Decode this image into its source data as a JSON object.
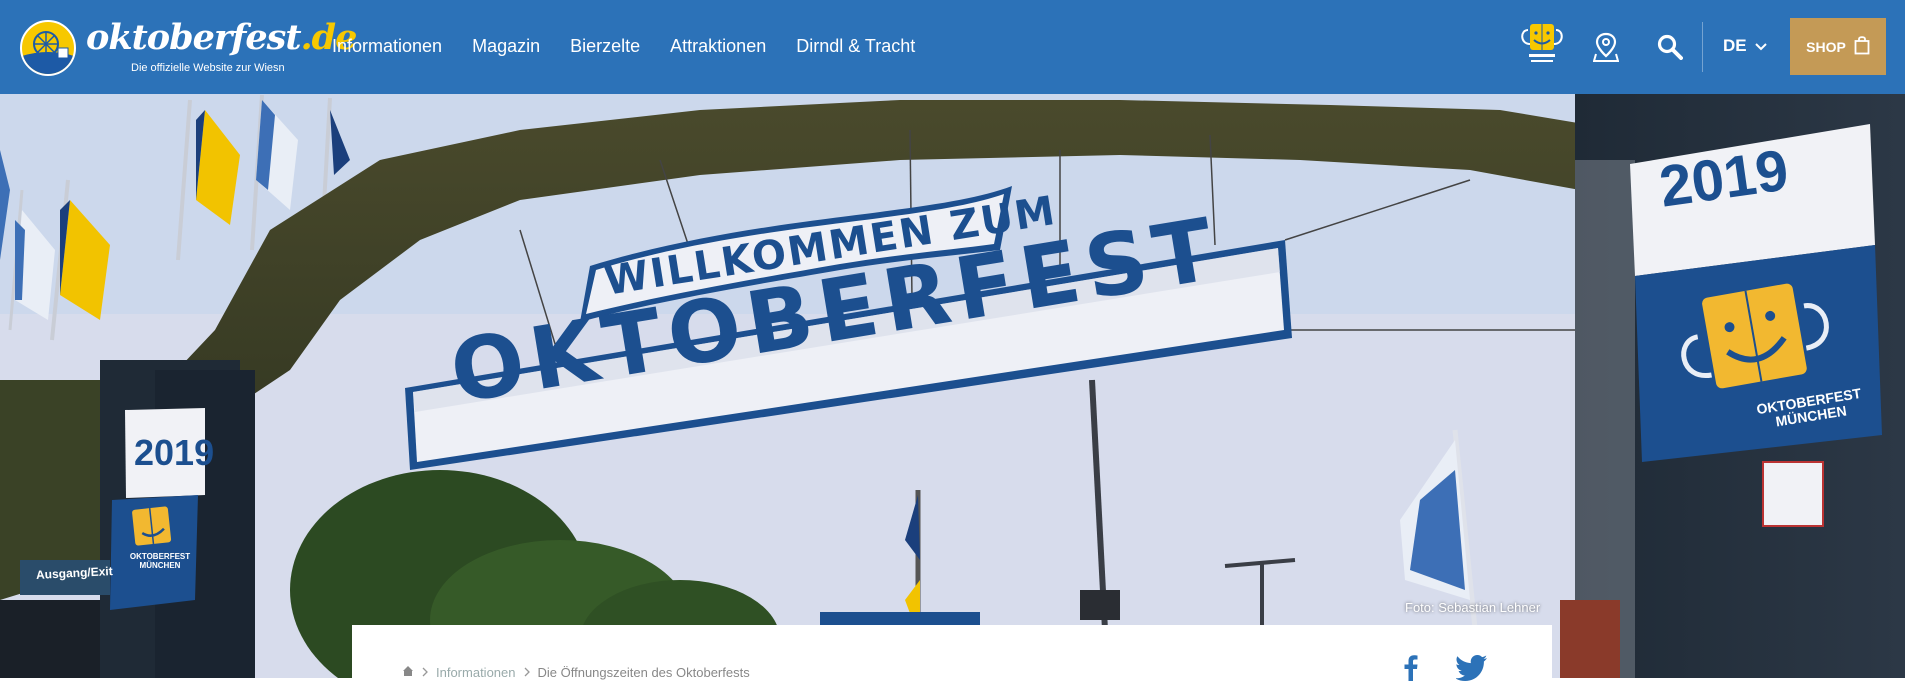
{
  "header": {
    "logo_name": "oktoberfest",
    "logo_tld": ".de",
    "logo_tagline": "Die offizielle Website zur Wiesn",
    "nav": [
      {
        "label": "Informationen"
      },
      {
        "label": "Magazin"
      },
      {
        "label": "Bierzelte"
      },
      {
        "label": "Attraktionen"
      },
      {
        "label": "Dirndl & Tracht"
      }
    ],
    "oktoberfest_badge_text": "OKTOBERFEST MÜNCHEN",
    "language": "DE",
    "shop_label": "SHOP"
  },
  "hero": {
    "sign_top": "WILLKOMMEN ZUM",
    "sign_main": "OKTOBERFEST",
    "year_right": "2019",
    "year_left": "2019",
    "pillar_logo_text": "OKTOBERFEST MÜNCHEN",
    "exit_sign": "Ausgang/Exit",
    "photo_credit": "Foto: Sebastian Lehner"
  },
  "breadcrumb": {
    "items": [
      "Informationen",
      "Die Öffnungszeiten des Oktoberfests"
    ]
  },
  "colors": {
    "header_bg": "#2c72b8",
    "accent_yellow": "#f7c800",
    "shop_bg": "#c49a56",
    "sign_blue": "#1c4f8f"
  },
  "icons": {
    "logo": "ferris-wheel-icon",
    "oktoberfest_badge": "oktoberfest-smiley-icon",
    "map": "map-pin-icon",
    "search": "search-icon",
    "language_caret": "chevron-down-icon",
    "shop": "shopping-bag-icon",
    "home": "home-icon",
    "facebook": "facebook-icon",
    "twitter": "twitter-icon"
  }
}
